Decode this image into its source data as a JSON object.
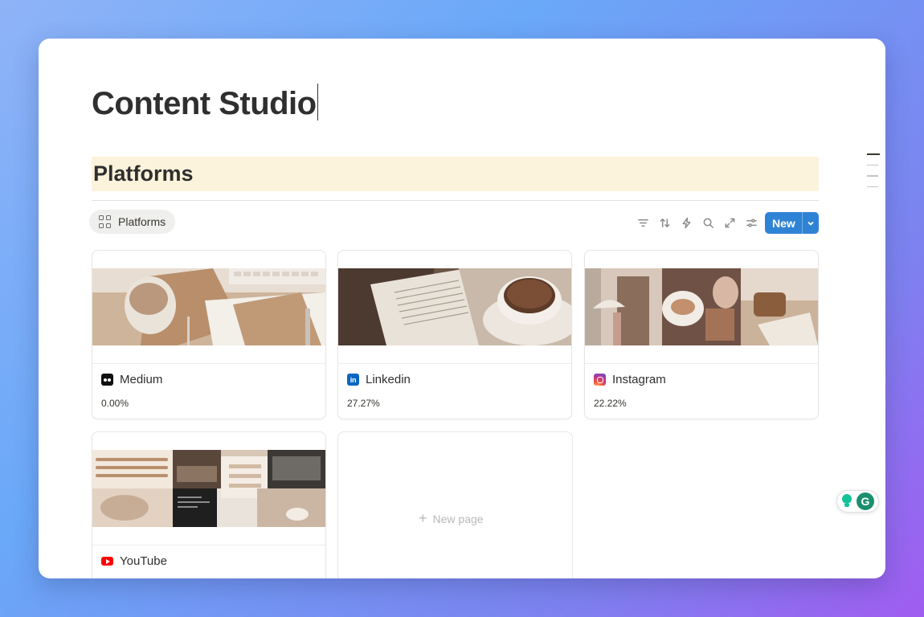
{
  "page": {
    "title": "Content Studio"
  },
  "section": {
    "heading": "Platforms"
  },
  "view": {
    "tab_label": "Platforms"
  },
  "toolbar": {
    "icons": [
      "filter-icon",
      "sort-icon",
      "automation-icon",
      "search-icon",
      "expand-icon",
      "settings-icon"
    ],
    "new_label": "New"
  },
  "cards": [
    {
      "name": "Medium",
      "percent": "0.00%",
      "icon": "medium-icon"
    },
    {
      "name": "Linkedin",
      "percent": "27.27%",
      "icon": "linkedin-icon"
    },
    {
      "name": "Instagram",
      "percent": "22.22%",
      "icon": "instagram-icon"
    },
    {
      "name": "YouTube",
      "percent": "",
      "icon": "youtube-icon"
    }
  ],
  "new_page_label": "New page",
  "colors": {
    "heading_highlight": "#fbf3db",
    "new_button": "#2f83d5",
    "background_start": "#8fb3f7",
    "background_end": "#a05cf0"
  }
}
